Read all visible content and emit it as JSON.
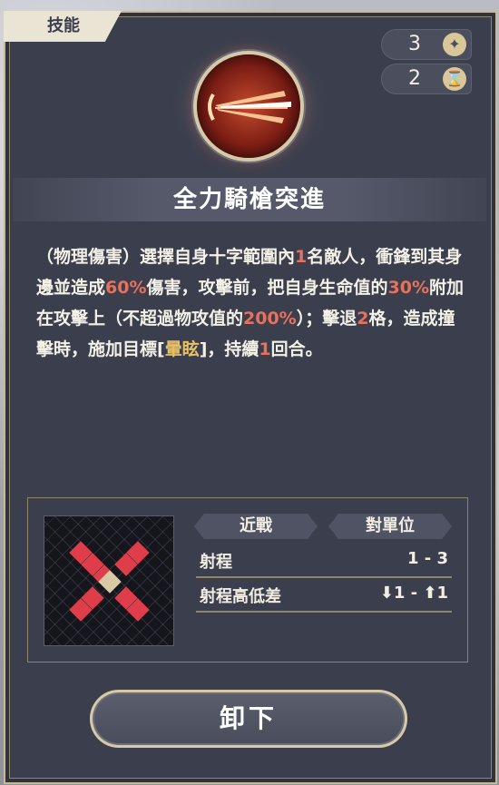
{
  "tab": {
    "label": "技能"
  },
  "counters": [
    {
      "value": "3",
      "icon": "sparkle-icon"
    },
    {
      "value": "2",
      "icon": "hourglass-icon"
    }
  ],
  "skill": {
    "name": "全力騎槍突進",
    "description": {
      "p1": "（物理傷害）選擇自身十字範圍內",
      "n1": "1",
      "p2": "名敵人，衝鋒到其身邊並造成",
      "n2": "60%",
      "p3": "傷害，攻擊前，把自身生命值的",
      "n3": "30%",
      "p4": "附加在攻擊上（不超過物攻值的",
      "n4": "200%",
      "p5": "）；擊退",
      "n5": "2",
      "p6": "格，造成撞擊時，施加目標[",
      "status": "暈眩",
      "p7": "]，持續",
      "n6": "1",
      "p8": "回合。"
    }
  },
  "stats": {
    "attack_type": "近戰",
    "target_type": "對單位",
    "range_label": "射程",
    "range_value": "1 - 3",
    "height_label": "射程高低差",
    "height_value": "⬇1 - ⬆1"
  },
  "colors": {
    "highlight": "#e8715c",
    "status": "#e8c061",
    "range_cell": "#e03d4a"
  },
  "button": {
    "unload_label": "卸下"
  }
}
